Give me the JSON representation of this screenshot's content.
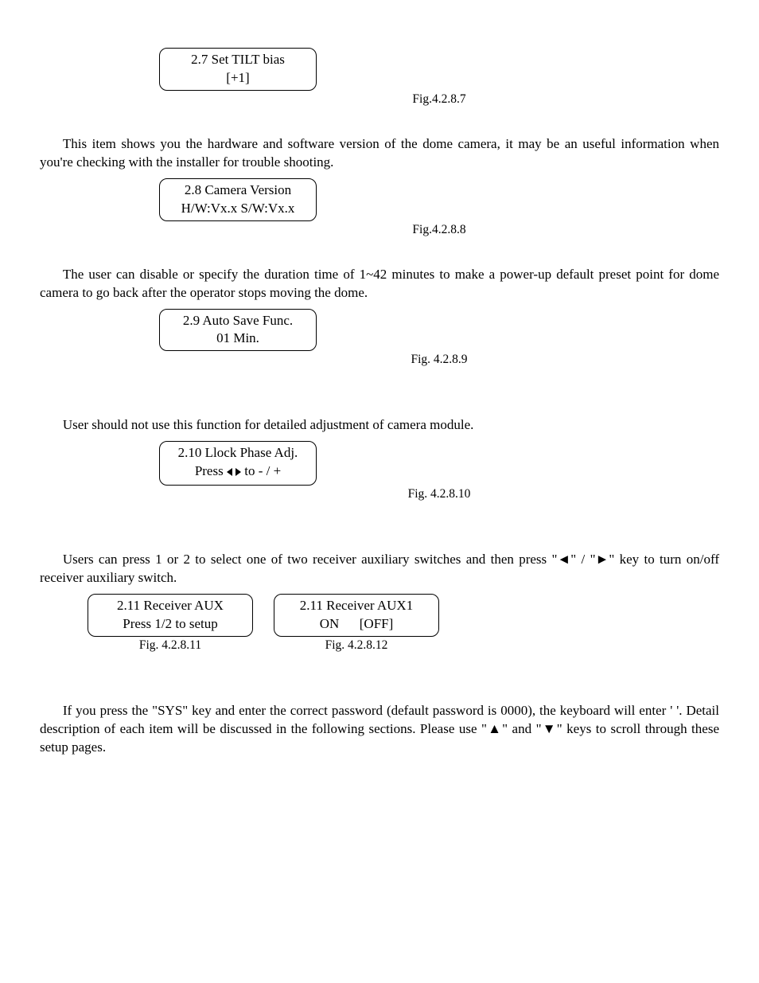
{
  "fig1": {
    "title": "2.7 Set TILT bias",
    "value": "[+1]",
    "caption": "Fig.4.2.8.7"
  },
  "para1": "This item shows you the hardware and software version of the dome camera, it may be an useful information when you're checking with the installer for trouble shooting.",
  "fig2": {
    "title": "2.8 Camera Version",
    "value": "H/W:Vx.x S/W:Vx.x",
    "caption": "Fig.4.2.8.8"
  },
  "para2": "The user can disable or specify the duration time of 1~42 minutes to make a power-up default preset point for dome camera to go back after the operator stops moving the dome.",
  "fig3": {
    "title": "2.9 Auto Save Func.",
    "value": "01 Min.",
    "caption": "Fig. 4.2.8.9"
  },
  "para3": "User should not use this function for detailed adjustment of camera module.",
  "fig4": {
    "title": "2.10 Llock Phase Adj.",
    "value_prefix": "Press ",
    "value_suffix": " to - / +",
    "caption": "Fig. 4.2.8.10"
  },
  "para4": "Users can press 1 or 2 to select one of two receiver auxiliary switches and then press \"◄\" / \"►\" key to turn on/off receiver auxiliary switch.",
  "fig5": {
    "title": "2.11 Receiver AUX",
    "value": "Press 1/2 to setup",
    "caption": "Fig. 4.2.8.11"
  },
  "fig6": {
    "title": "2.11 Receiver AUX1",
    "value": "ON      [OFF]",
    "caption": "Fig. 4.2.8.12"
  },
  "para5": "If you press the \"SYS\" key and enter the correct password (default password is 0000), the keyboard will enter '                           '. Detail description of each item will be discussed in the following sections. Please use \"▲\" and \"▼\" keys to scroll through these setup pages."
}
